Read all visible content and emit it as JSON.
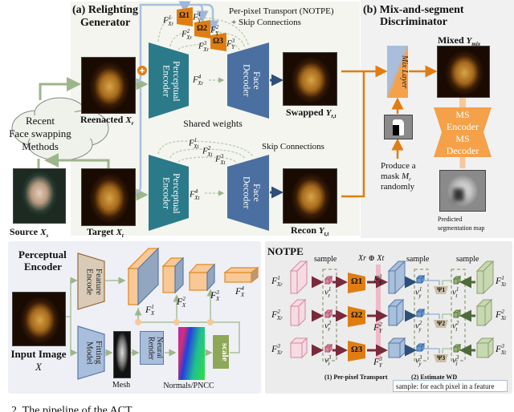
{
  "relighting_generator": {
    "title_line1": "(a) Relighting",
    "title_line2": "Generator",
    "cloud_line1": "Recent",
    "cloud_line2": "Face swapping",
    "cloud_line3": "Methods",
    "reenacted_label": "Reenacted",
    "reenacted_var": {
      "b": "X",
      "sub": "r"
    },
    "target_label": "Target",
    "target_var": {
      "b": "X",
      "sub": "t"
    },
    "source_label": "Source",
    "source_var": {
      "b": "X",
      "sub": "s"
    },
    "encoder_label": "Perceptual Encoder",
    "decoder_label": "Face Decoder",
    "notpe_line1": "Per-pixel Transport (NOTPE)",
    "notpe_line2": "+ Skip Connections",
    "skip_label": "Skip Connections",
    "shared_weights": "Shared weights",
    "swapped_label": "Swapped",
    "swapped_var": {
      "b": "Y",
      "sub": "r,t"
    },
    "recon_label": "Recon",
    "recon_var": {
      "b": "Y",
      "sub": "t,t"
    },
    "omegas": [
      "Ω1",
      "Ω2",
      "Ω3"
    ],
    "top_features": [
      {
        "b": "F",
        "sup": "1",
        "sub": "Xr"
      },
      {
        "b": "F",
        "sup": "2",
        "sub": "Xr"
      },
      {
        "b": "F",
        "sup": "3",
        "sub": "Xr"
      },
      {
        "b": "F",
        "sup": "4",
        "sub": "Xr"
      }
    ],
    "top_outputs": [
      {
        "b": "F",
        "sup": "1",
        "sub": "Y"
      },
      {
        "b": "F",
        "sup": "2",
        "sub": "Y"
      },
      {
        "b": "F",
        "sup": "3",
        "sub": "Y"
      }
    ],
    "bottom_features": [
      {
        "b": "F",
        "sup": "1",
        "sub": "Xt"
      },
      {
        "b": "F",
        "sup": "2",
        "sub": "Xt"
      },
      {
        "b": "F",
        "sup": "3",
        "sub": "Xt"
      },
      {
        "b": "F",
        "sup": "4",
        "sub": "Xt"
      }
    ]
  },
  "discriminator": {
    "title_line1": "(b) Mix-and-segment",
    "title_line2": "Discriminator",
    "mix_layer": "Mix Layer",
    "mixed_label": "Mixed",
    "mixed_var": {
      "b": "Y",
      "sub": "mix"
    },
    "ms_line1": "MS",
    "ms_line2": "Encoder",
    "ms_line3": "MS",
    "ms_line4": "Decoder",
    "mask_line1": "Produce a",
    "mask_line2": "mask",
    "mask_var": {
      "b": "M",
      "sub": "r"
    },
    "mask_line3": "randomly",
    "pred_line1": "Predicted",
    "pred_line2": "segmentation map"
  },
  "perceptual_encoder": {
    "title_line1": "Perceptual",
    "title_line2": "Encoder",
    "feature_encode": "Feature Encode",
    "fitting_model": "Fitting Model",
    "neural_render": "Neural Render",
    "scale": "scale",
    "mesh": "Mesh",
    "normals": "Normals/PNCC",
    "input_label": "Input Image",
    "input_var": "X",
    "features": [
      {
        "b": "F",
        "sup": "1",
        "sub": "X"
      },
      {
        "b": "F",
        "sup": "2",
        "sub": "X"
      },
      {
        "b": "F",
        "sup": "3",
        "sub": "X"
      },
      {
        "b": "F",
        "sup": "4",
        "sub": "X"
      }
    ]
  },
  "notpe": {
    "title": "NOTPE",
    "sample": "sample",
    "concat": "Xr ⊕ Xt",
    "fxr": [
      {
        "b": "F",
        "sup": "1",
        "sub": "Xr"
      },
      {
        "b": "F",
        "sup": "2",
        "sub": "Xr"
      },
      {
        "b": "F",
        "sup": "3",
        "sub": "Xr"
      }
    ],
    "vr": [
      {
        "b": "v",
        "sub": "r",
        "sup": "1"
      },
      {
        "b": "v",
        "sub": "r",
        "sup": "2"
      },
      {
        "b": "v",
        "sub": "r",
        "sup": "3"
      }
    ],
    "fy": [
      {
        "b": "F",
        "sup": "1",
        "sub": "Y"
      },
      {
        "b": "F",
        "sup": "2",
        "sub": "Y"
      },
      {
        "b": "F",
        "sup": "3",
        "sub": "Y"
      }
    ],
    "vy": [
      {
        "b": "v",
        "sub": "y",
        "sup": "1"
      },
      {
        "b": "v",
        "sub": "y",
        "sup": "2"
      },
      {
        "b": "v",
        "sub": "y",
        "sup": "3"
      }
    ],
    "vt": [
      {
        "b": "v",
        "sub": "t",
        "sup": "1"
      },
      {
        "b": "v",
        "sub": "t",
        "sup": "2"
      },
      {
        "b": "v",
        "sub": "t",
        "sup": "3"
      }
    ],
    "fxt": [
      {
        "b": "F",
        "sup": "1",
        "sub": "Xt"
      },
      {
        "b": "F",
        "sup": "2",
        "sub": "Xt"
      },
      {
        "b": "F",
        "sup": "3",
        "sub": "Xt"
      }
    ],
    "omegas": [
      "Ω1",
      "Ω2",
      "Ω3"
    ],
    "psis": [
      "Ψ1",
      "Ψ2",
      "Ψ3"
    ],
    "step1": "(1) Per-pixel Transport",
    "step2": "(2) Estimate WD",
    "legend": "sample: for each pixel in a feature"
  },
  "caption": "2. The pipeline of the ACT",
  "colors": {
    "orange": "#e07d12",
    "teal": "#2b7a8a",
    "blue": "#4a6fa0",
    "green_line": "#9db58a",
    "light_blue": "#a9c0dc",
    "ms_orange": "#f4a14a"
  }
}
